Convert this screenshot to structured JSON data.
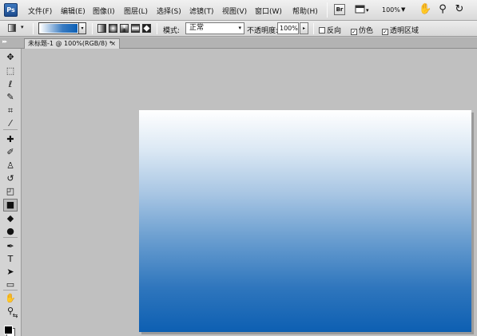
{
  "app": {
    "logo": "Ps"
  },
  "menu": [
    "文件(F)",
    "编辑(E)",
    "图像(I)",
    "图层(L)",
    "选择(S)",
    "滤镜(T)",
    "视图(V)",
    "窗口(W)",
    "帮助(H)"
  ],
  "menubar_right": {
    "bridge": "Br",
    "zoom": "100%",
    "zoom_arrow": "▼",
    "icons": [
      "screen-mode-icon",
      "hand-icon",
      "zoom-icon",
      "rotate-view-icon"
    ]
  },
  "options": {
    "gradient_dropdown": "▾",
    "mode_label": "模式:",
    "mode_value": "正常",
    "mode_arrow": "▾",
    "opacity_label": "不透明度:",
    "opacity_value": "100%",
    "opacity_arrow": "▸",
    "reverse": {
      "label": "反向",
      "checked": false
    },
    "dither": {
      "label": "仿色",
      "checked": true
    },
    "transparency": {
      "label": "透明区域",
      "checked": true
    }
  },
  "document": {
    "tab_title": "未标题-1 @ 100%(RGB/8) *",
    "close": "×",
    "collapse": "▸▸"
  },
  "colors": {
    "gradient_start": "#ffffff",
    "gradient_end": "#0d5fb2",
    "foreground": "#000000",
    "background": "#ffffff"
  },
  "tools": [
    {
      "name": "move-tool",
      "icon": "✥"
    },
    {
      "name": "marquee-tool",
      "icon": "⬚"
    },
    {
      "name": "lasso-tool",
      "icon": "ℓ"
    },
    {
      "name": "quick-select-tool",
      "icon": "✎"
    },
    {
      "name": "crop-tool",
      "icon": "⌗"
    },
    {
      "name": "eyedropper-tool",
      "icon": "⁄"
    },
    {
      "name": "healing-brush-tool",
      "icon": "✚"
    },
    {
      "name": "brush-tool",
      "icon": "✐"
    },
    {
      "name": "clone-stamp-tool",
      "icon": "♙"
    },
    {
      "name": "history-brush-tool",
      "icon": "↺"
    },
    {
      "name": "eraser-tool",
      "icon": "◰"
    },
    {
      "name": "gradient-tool",
      "icon": "■"
    },
    {
      "name": "blur-tool",
      "icon": "◆"
    },
    {
      "name": "dodge-tool",
      "icon": "●"
    },
    {
      "name": "pen-tool",
      "icon": "✒"
    },
    {
      "name": "type-tool",
      "icon": "T"
    },
    {
      "name": "path-select-tool",
      "icon": "➤"
    },
    {
      "name": "shape-tool",
      "icon": "▭"
    },
    {
      "name": "hand-tool",
      "icon": "✋"
    },
    {
      "name": "zoom-tool",
      "icon": "⚲"
    }
  ]
}
